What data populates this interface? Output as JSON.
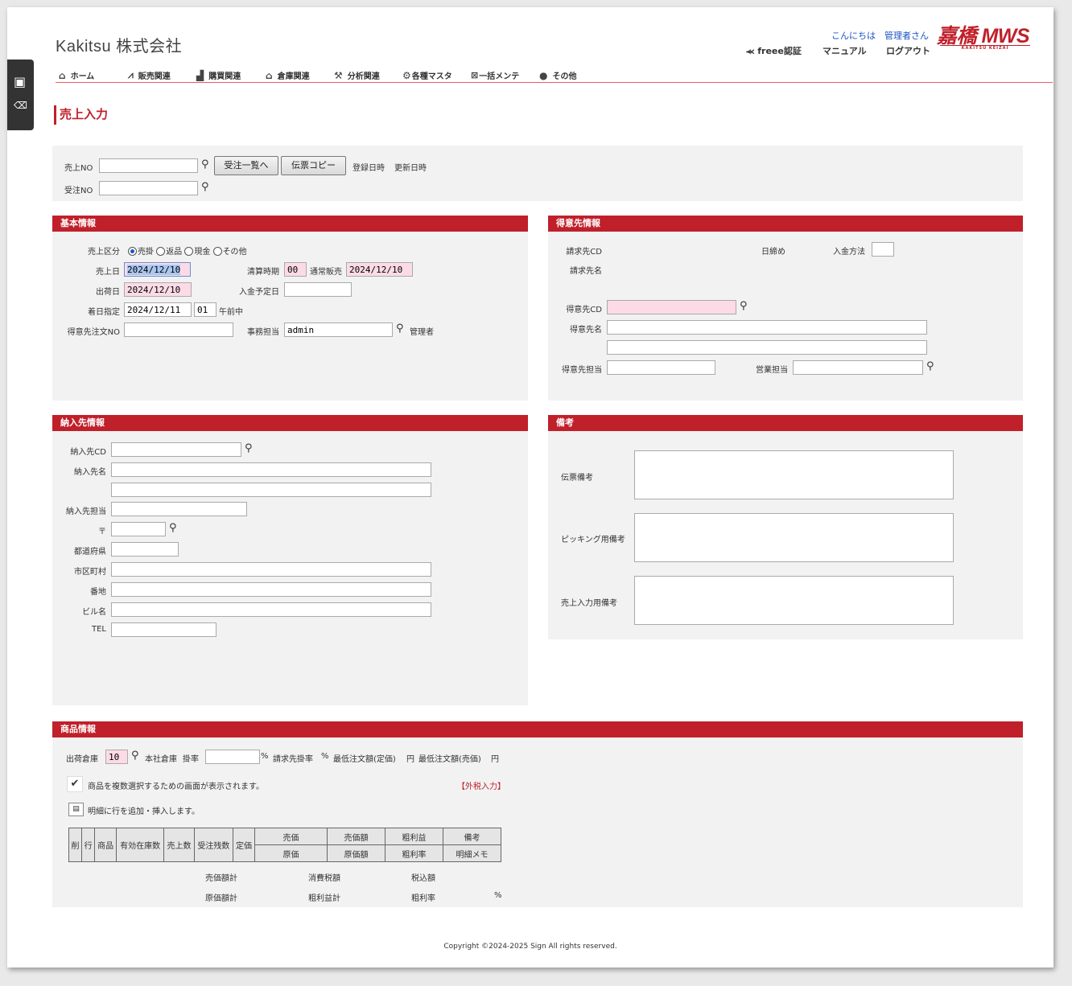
{
  "header": {
    "company": "Kakitsu 株式会社",
    "greeting": "こんにちは",
    "user": "管理者さん",
    "freee": "freee認証",
    "manual": "マニュアル",
    "logout": "ログアウト",
    "logo_main": "嘉橋 MWS",
    "logo_sub": "KAKITSU KEIZAI"
  },
  "nav": [
    {
      "label": "ホーム",
      "icon": "home-icon"
    },
    {
      "label": "販売関連",
      "icon": "chart-icon"
    },
    {
      "label": "購買関連",
      "icon": "factory-icon"
    },
    {
      "label": "倉庫関連",
      "icon": "warehouse-icon"
    },
    {
      "label": "分析関連",
      "icon": "analysis-icon"
    },
    {
      "label": "各種マスタ",
      "icon": "gear-icon"
    },
    {
      "label": "一括メンテ",
      "icon": "excel-icon"
    },
    {
      "label": "その他",
      "icon": "more-icon"
    }
  ],
  "page_title": "売上入力",
  "top": {
    "sales_no_label": "売上NO",
    "order_no_label": "受注NO",
    "btn_orders": "受注一覧へ",
    "btn_copy": "伝票コピー",
    "reg_date": "登録日時",
    "upd_date": "更新日時"
  },
  "basic": {
    "header": "基本情報",
    "type_label": "売上区分",
    "types": [
      "売掛",
      "返品",
      "現金",
      "その他"
    ],
    "sales_date_label": "売上日",
    "sales_date": "2024/12/10",
    "settle_label": "清算時期",
    "settle_code": "00",
    "settle_name": "通常販売",
    "settle_date": "2024/12/10",
    "ship_date_label": "出荷日",
    "ship_date": "2024/12/10",
    "pay_date_label": "入金予定日",
    "arrive_label": "着日指定",
    "arrive_date": "2024/12/11",
    "arrive_code": "01",
    "arrive_name": "午前中",
    "cust_order_label": "得意先注文NO",
    "staff_label": "事務担当",
    "staff": "admin",
    "staff_name": "管理者"
  },
  "customer": {
    "header": "得意先情報",
    "bill_cd": "請求先CD",
    "closing": "日締め",
    "pay_method": "入金方法",
    "bill_name": "請求先名",
    "cust_cd": "得意先CD",
    "cust_name": "得意先名",
    "cust_staff": "得意先担当",
    "sales_staff": "営業担当"
  },
  "delivery": {
    "header": "納入先情報",
    "cd": "納入先CD",
    "name": "納入先名",
    "staff": "納入先担当",
    "zip": "〒",
    "pref": "都道府県",
    "city": "市区町村",
    "addr": "番地",
    "bldg": "ビル名",
    "tel": "TEL"
  },
  "notes": {
    "header": "備考",
    "slip": "伝票備考",
    "picking": "ピッキング用備考",
    "sales": "売上入力用備考"
  },
  "products": {
    "header": "商品情報",
    "warehouse_label": "出荷倉庫",
    "warehouse_code": "10",
    "warehouse_name": "本社倉庫",
    "rate_label": "掛率",
    "pct": "%",
    "bill_rate": "請求先掛率",
    "pct2": "%",
    "min_list": "最低注文額(定価)",
    "yen1": "円",
    "min_sale": "最低注文額(売価)",
    "yen2": "円",
    "multi_msg": "商品を複数選択するための画面が表示されます。",
    "tax": "【外税入力】",
    "add_row_msg": "明細に行を追加・挿入します。",
    "cols": [
      "削",
      "行",
      "商品",
      "有効在庫数",
      "売上数",
      "受注残数",
      "定価"
    ],
    "cols_top": [
      "売価",
      "売価額",
      "粗利益",
      "備考"
    ],
    "cols_bot": [
      "原価",
      "原価額",
      "粗利率",
      "明細メモ"
    ],
    "sum_sale": "売価額計",
    "sum_tax": "消費税額",
    "sum_incl": "税込額",
    "sum_cost": "原価額計",
    "sum_profit": "粗利益計",
    "sum_rate": "粗利率",
    "sum_pct": "%"
  },
  "footer": "Copyright ©2024-2025 Sign All rights reserved."
}
